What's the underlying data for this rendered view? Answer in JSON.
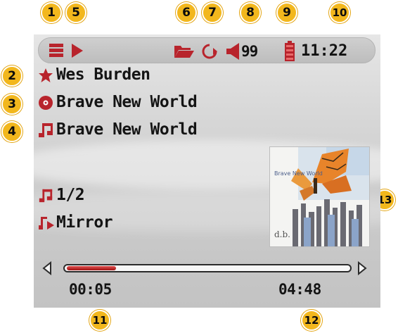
{
  "callouts": [
    "1",
    "2",
    "3",
    "4",
    "5",
    "6",
    "7",
    "8",
    "9",
    "10",
    "11",
    "12",
    "13"
  ],
  "statusbar": {
    "volume": "99",
    "clock": "11:22",
    "icons": [
      "playlist-icon",
      "play-icon",
      "folder-icon",
      "repeat-icon",
      "speaker-icon",
      "battery-icon"
    ]
  },
  "track_info": {
    "artist": "Wes Burden",
    "album": "Brave New World",
    "title": "Brave New World",
    "track_counter": "1/2",
    "next_track": "Mirror"
  },
  "playback": {
    "elapsed": "00:05",
    "total": "04:48",
    "progress_fraction": 0.035
  },
  "album_art": {
    "caption": "Brave New World"
  },
  "colors": {
    "accent": "#c0202a",
    "callout": "#f2b71d",
    "text": "#141414"
  }
}
